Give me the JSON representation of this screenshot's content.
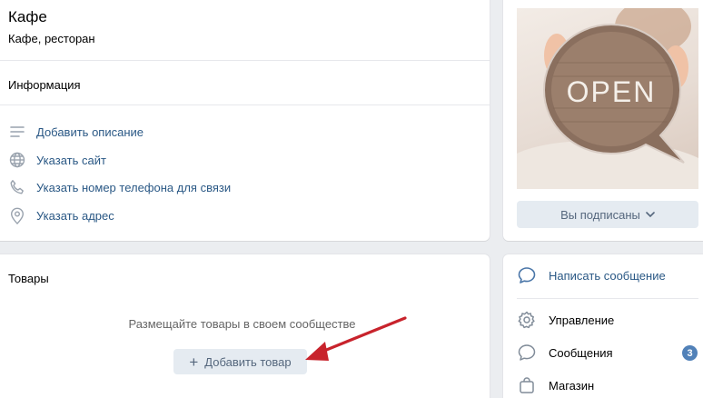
{
  "group": {
    "name": "Кафе",
    "category": "Кафе, ресторан"
  },
  "info": {
    "title": "Информация",
    "items": [
      {
        "label": "Добавить описание",
        "icon": "lines-icon"
      },
      {
        "label": "Указать сайт",
        "icon": "globe-icon"
      },
      {
        "label": "Указать номер телефона для связи",
        "icon": "phone-icon"
      },
      {
        "label": "Указать адрес",
        "icon": "location-pin-icon"
      }
    ]
  },
  "goods": {
    "title": "Товары",
    "hint": "Размещайте товары в своем сообществе",
    "add_label": "Добавить товар"
  },
  "cover": {
    "sign_text": "OPEN",
    "subscribe_label": "Вы подписаны"
  },
  "menu": {
    "items": [
      {
        "label": "Написать сообщение",
        "icon": "message-bubble-icon"
      },
      {
        "label": "Управление",
        "icon": "gear-icon"
      },
      {
        "label": "Сообщения",
        "icon": "chat-bubble-icon",
        "badge": "3"
      },
      {
        "label": "Магазин",
        "icon": "shopping-bag-icon"
      }
    ]
  },
  "colors": {
    "link": "#2a5885",
    "button_bg": "#e5ebf1",
    "badge": "#5181b8",
    "arrow": "#c8232c"
  }
}
